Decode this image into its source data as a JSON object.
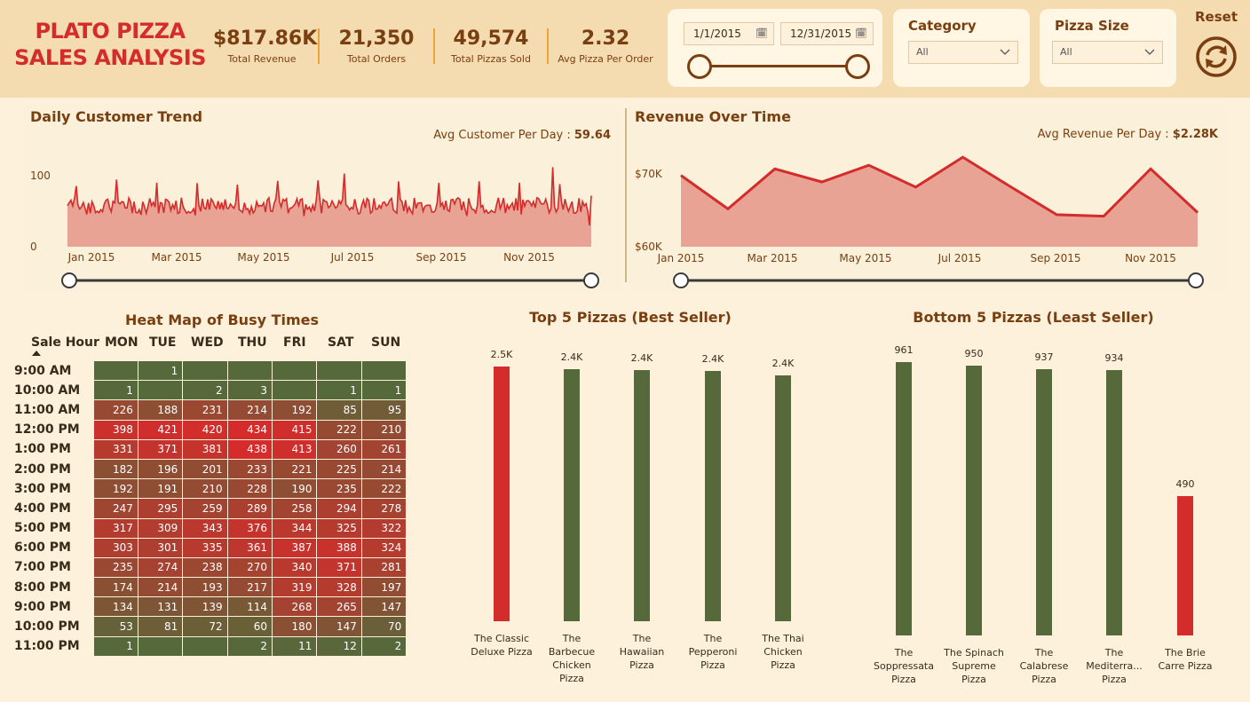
{
  "header": {
    "title_line1": "PLATO PIZZA",
    "title_line2": "SALES ANALYSIS",
    "kpis": [
      {
        "value": "$817.86K",
        "label": "Total Revenue"
      },
      {
        "value": "21,350",
        "label": "Total Orders"
      },
      {
        "value": "49,574",
        "label": "Total Pizzas Sold"
      },
      {
        "value": "2.32",
        "label": "Avg Pizza Per Order"
      }
    ],
    "date_start": "1/1/2015",
    "date_end": "12/31/2015",
    "category_label": "Category",
    "category_value": "All",
    "size_label": "Pizza Size",
    "size_value": "All",
    "reset_label": "Reset"
  },
  "colors": {
    "red": "#d42b2b",
    "green": "#56693a",
    "area_fill": "#e8a394",
    "header_bg": "#f4dbb0",
    "page_bg": "#fdf1dc"
  },
  "chart_data": [
    {
      "id": "daily",
      "type": "area",
      "title": "Daily Customer Trend",
      "annotation_label": "Avg Customer Per Day : ",
      "annotation_value": "59.64",
      "x_ticks": [
        "Jan 2015",
        "Mar 2015",
        "May 2015",
        "Jul 2015",
        "Sep 2015",
        "Nov 2015"
      ],
      "y_ticks": [
        "100",
        "0"
      ],
      "ylim": [
        0,
        100
      ]
    },
    {
      "id": "revenue",
      "type": "area",
      "title": "Revenue Over Time",
      "annotation_label": "Avg Revenue Per Day : ",
      "annotation_value": "$2.28K",
      "x_ticks": [
        "Jan 2015",
        "Mar 2015",
        "May 2015",
        "Jul 2015",
        "Sep 2015",
        "Nov 2015"
      ],
      "y_ticks": [
        "$70K",
        "$60K"
      ],
      "ylim": [
        60000,
        70000
      ],
      "x": [
        "Jan 2015",
        "Feb 2015",
        "Mar 2015",
        "Apr 2015",
        "May 2015",
        "Jun 2015",
        "Jul 2015",
        "Aug 2015",
        "Sep 2015",
        "Oct 2015",
        "Nov 2015",
        "Dec 2015"
      ],
      "values": [
        69800,
        65200,
        70700,
        68900,
        71200,
        68200,
        72300,
        68300,
        64400,
        64200,
        70700,
        64700
      ]
    },
    {
      "id": "heatmap",
      "type": "heatmap",
      "title": "Heat Map of Busy Times",
      "row_header": "Sale Hour",
      "columns": [
        "MON",
        "TUE",
        "WED",
        "THU",
        "FRI",
        "SAT",
        "SUN"
      ],
      "rows": [
        "9:00 AM",
        "10:00 AM",
        "11:00 AM",
        "12:00 PM",
        "1:00 PM",
        "2:00 PM",
        "3:00 PM",
        "4:00 PM",
        "5:00 PM",
        "6:00 PM",
        "7:00 PM",
        "8:00 PM",
        "9:00 PM",
        "10:00 PM",
        "11:00 PM"
      ],
      "values": [
        [
          null,
          1,
          null,
          null,
          null,
          null,
          null
        ],
        [
          1,
          null,
          2,
          3,
          null,
          1,
          1
        ],
        [
          226,
          188,
          231,
          214,
          192,
          85,
          95
        ],
        [
          398,
          421,
          420,
          434,
          415,
          222,
          210
        ],
        [
          331,
          371,
          381,
          438,
          413,
          260,
          261
        ],
        [
          182,
          196,
          201,
          233,
          221,
          225,
          214
        ],
        [
          192,
          191,
          210,
          228,
          190,
          235,
          222
        ],
        [
          247,
          295,
          259,
          289,
          258,
          294,
          278
        ],
        [
          317,
          309,
          343,
          376,
          344,
          325,
          322
        ],
        [
          303,
          301,
          335,
          361,
          387,
          388,
          324
        ],
        [
          235,
          274,
          238,
          270,
          340,
          371,
          281
        ],
        [
          174,
          214,
          193,
          217,
          319,
          328,
          197
        ],
        [
          134,
          131,
          139,
          114,
          268,
          265,
          147
        ],
        [
          53,
          81,
          72,
          60,
          180,
          147,
          70
        ],
        [
          1,
          null,
          null,
          2,
          11,
          12,
          2
        ]
      ]
    },
    {
      "id": "top5",
      "type": "bar",
      "title": "Top 5 Pizzas (Best Seller)",
      "categories": [
        "The Classic Deluxe Pizza",
        "The Barbecue Chicken Pizza",
        "The Hawaiian Pizza",
        "The Pepperoni Pizza",
        "The Thai Chicken Pizza"
      ],
      "values": [
        2453,
        2432,
        2422,
        2418,
        2371
      ],
      "data_labels": [
        "2.5K",
        "2.4K",
        "2.4K",
        "2.4K",
        "2.4K"
      ],
      "ylim": [
        0,
        2500
      ]
    },
    {
      "id": "bottom5",
      "type": "bar",
      "title": "Bottom 5 Pizzas (Least Seller)",
      "categories": [
        "The Soppressata Pizza",
        "The Spinach Supreme Pizza",
        "The Calabrese Pizza",
        "The Mediterra... Pizza",
        "The Brie Carre Pizza"
      ],
      "values": [
        961,
        950,
        937,
        934,
        490
      ],
      "data_labels": [
        "961",
        "950",
        "937",
        "934",
        "490"
      ],
      "ylim": [
        0,
        961
      ]
    }
  ]
}
